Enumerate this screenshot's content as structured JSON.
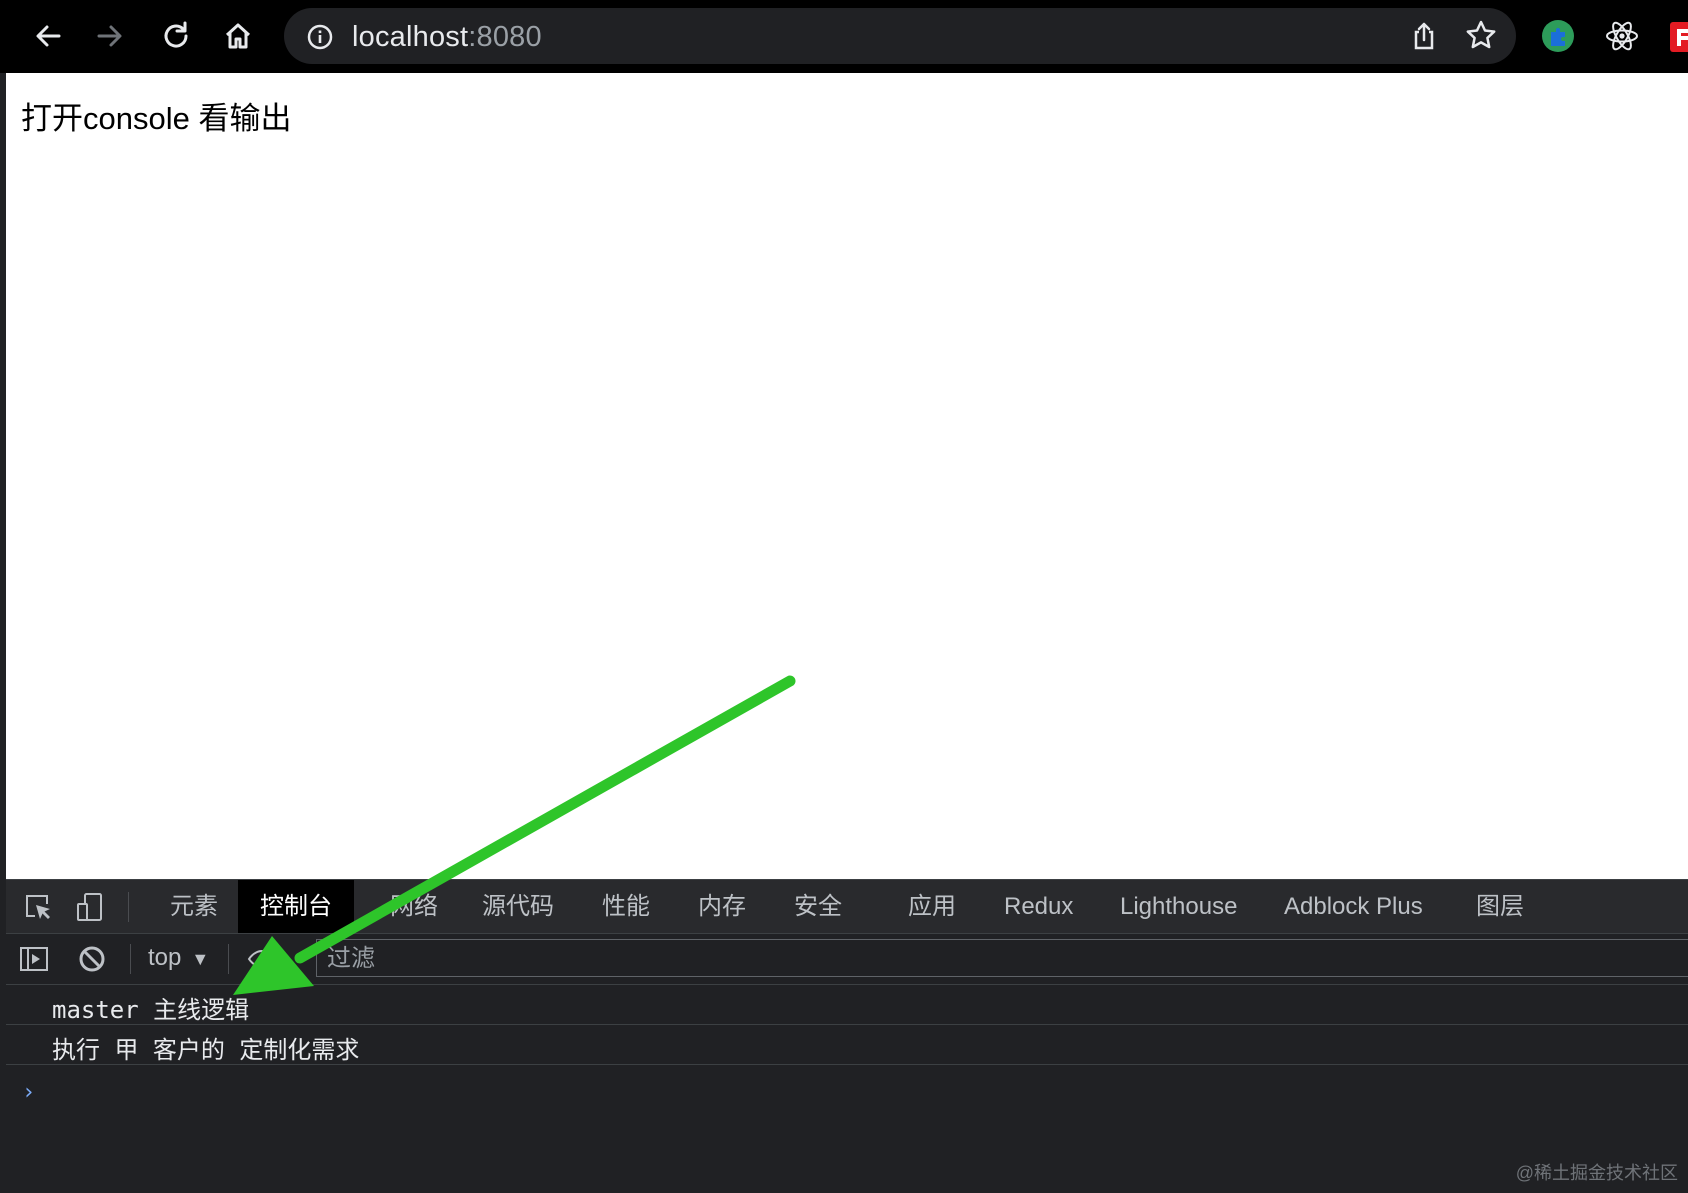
{
  "browser": {
    "url_host": "localhost",
    "url_port": ":8080"
  },
  "page": {
    "body_text": "打开console 看输出"
  },
  "devtools": {
    "tabs": [
      {
        "label": "元素"
      },
      {
        "label": "控制台",
        "active": true
      },
      {
        "label": "网络"
      },
      {
        "label": "源代码"
      },
      {
        "label": "性能"
      },
      {
        "label": "内存"
      },
      {
        "label": "安全"
      },
      {
        "label": "应用"
      },
      {
        "label": "Redux"
      },
      {
        "label": "Lighthouse"
      },
      {
        "label": "Adblock Plus"
      },
      {
        "label": "图层"
      }
    ],
    "context": "top",
    "filter_placeholder": "过滤",
    "logs": [
      "master 主线逻辑",
      "执行 甲 客户的 定制化需求"
    ],
    "prompt": "›"
  },
  "annotation": {
    "arrow_color": "#2ec52a"
  },
  "watermark": "@稀土掘金技术社区"
}
